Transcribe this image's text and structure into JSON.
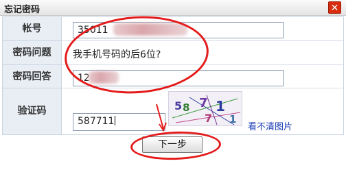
{
  "dialog": {
    "title": "忘记密码",
    "close_symbol": "✕"
  },
  "form": {
    "account": {
      "label": "帐号",
      "value": "35011"
    },
    "question": {
      "label": "密码问题",
      "text": "我手机号码的后6位?"
    },
    "answer": {
      "label": "密码回答",
      "value": "12"
    },
    "captcha": {
      "label": "验证码",
      "value": "587711",
      "image_text": [
        "5",
        "8",
        "7",
        "1",
        "7",
        "1"
      ],
      "refresh_link": "看不清图片"
    }
  },
  "actions": {
    "next_label": "下一步"
  },
  "colors": {
    "annotation": "#e41b1b",
    "link": "#1c3fb8",
    "label_bg": "#e9eef5",
    "close_bg": "#d92d0f"
  }
}
